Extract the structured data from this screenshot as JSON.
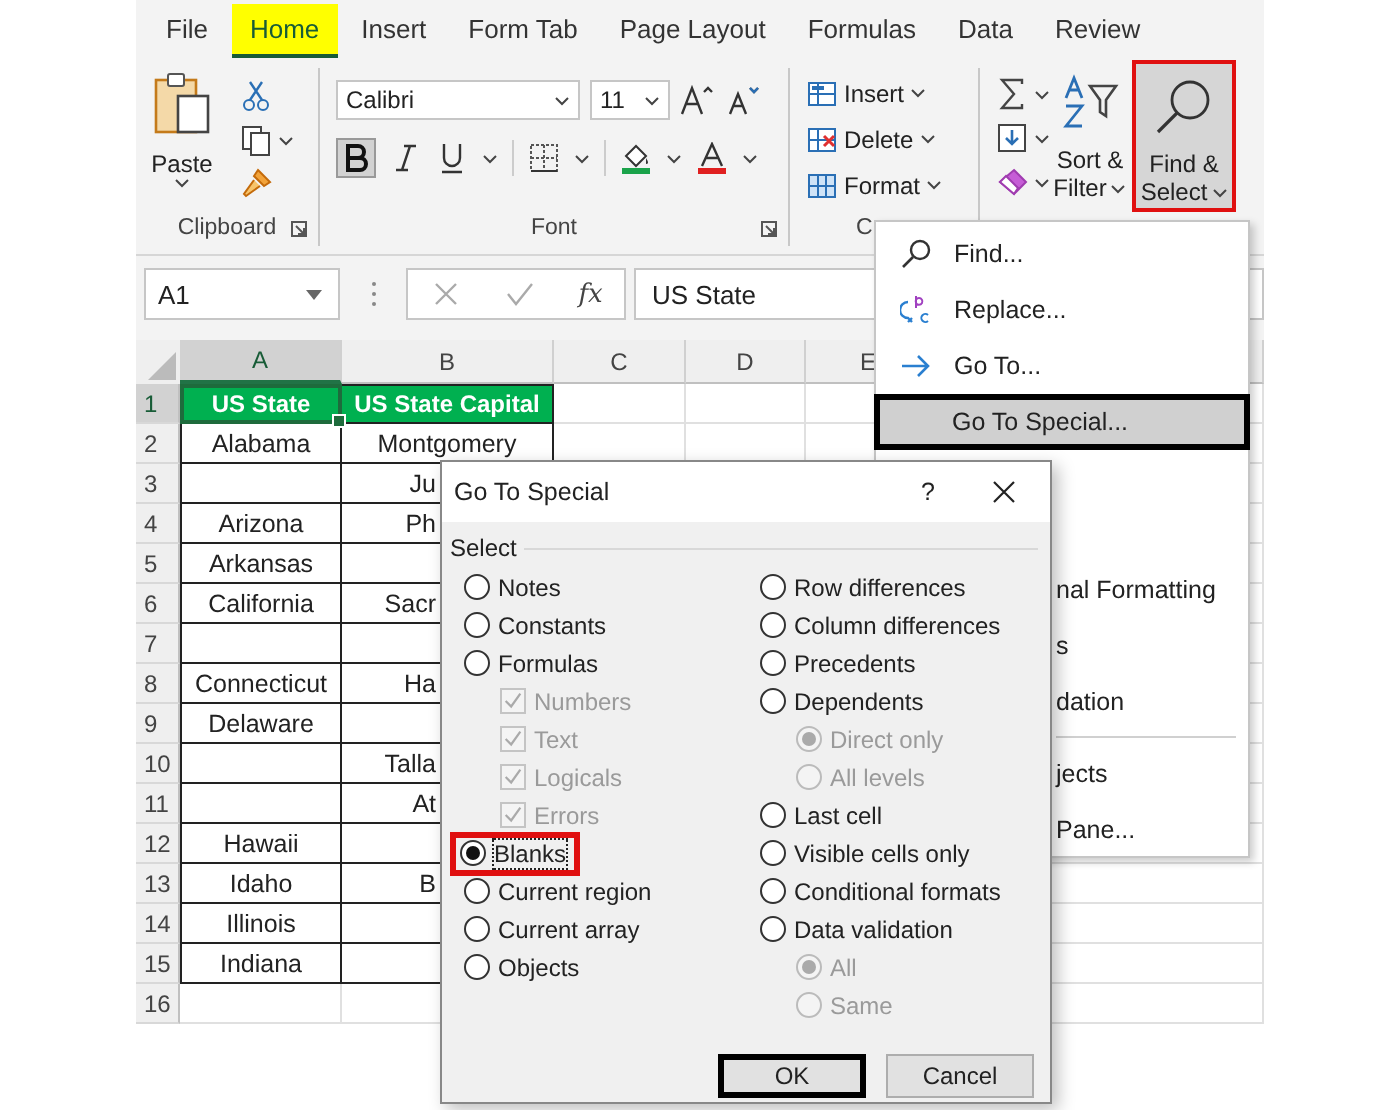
{
  "ribbon_tabs": [
    {
      "label": "File",
      "selected": false,
      "highlighted": false
    },
    {
      "label": "Home",
      "selected": true,
      "highlighted": true
    },
    {
      "label": "Insert",
      "selected": false,
      "highlighted": false
    },
    {
      "label": "Form Tab",
      "selected": false,
      "highlighted": false
    },
    {
      "label": "Page Layout",
      "selected": false,
      "highlighted": false
    },
    {
      "label": "Formulas",
      "selected": false,
      "highlighted": false
    },
    {
      "label": "Data",
      "selected": false,
      "highlighted": false
    },
    {
      "label": "Review",
      "selected": false,
      "highlighted": false
    }
  ],
  "ribbon": {
    "clipboard": {
      "paste_label": "Paste",
      "group_label": "Clipboard"
    },
    "font": {
      "font_name": "Calibri",
      "font_size": "11",
      "bold_on": true,
      "group_label": "Font"
    },
    "cells": {
      "buttons": [
        {
          "label": "Insert"
        },
        {
          "label": "Delete"
        },
        {
          "label": "Format"
        }
      ],
      "group_label": "C"
    },
    "editing": {
      "sort_label": "Sort &",
      "sort_label_2": "Filter",
      "find_label": "Find &",
      "find_label_2": "Select",
      "find_highlighted": true
    }
  },
  "formula_bar": {
    "name_box": "A1",
    "fx": "fx",
    "formula": "US State"
  },
  "sheet": {
    "columns": [
      {
        "label": "A",
        "selected": true
      },
      {
        "label": "B",
        "selected": false
      },
      {
        "label": "C",
        "selected": false
      },
      {
        "label": "D",
        "selected": false
      },
      {
        "label": "E",
        "selected": false
      }
    ],
    "rows": [
      {
        "number": "1",
        "selected": true,
        "kind": "header",
        "state": "US State",
        "capital": "US State Capital"
      },
      {
        "number": "2",
        "selected": false,
        "kind": "data",
        "state": "Alabama",
        "capital": "Montgomery"
      },
      {
        "number": "3",
        "selected": false,
        "kind": "data",
        "capital": "Ju"
      },
      {
        "number": "4",
        "selected": false,
        "kind": "data",
        "state": "Arizona",
        "capital": "Ph"
      },
      {
        "number": "5",
        "selected": false,
        "kind": "data",
        "state": "Arkansas"
      },
      {
        "number": "6",
        "selected": false,
        "kind": "data",
        "state": "California",
        "capital": "Sacr"
      },
      {
        "number": "7",
        "selected": false,
        "kind": "data"
      },
      {
        "number": "8",
        "selected": false,
        "kind": "data",
        "state": "Connecticut",
        "capital": "Ha"
      },
      {
        "number": "9",
        "selected": false,
        "kind": "data",
        "state": "Delaware"
      },
      {
        "number": "10",
        "selected": false,
        "kind": "data",
        "capital": "Talla"
      },
      {
        "number": "11",
        "selected": false,
        "kind": "data",
        "capital": "At"
      },
      {
        "number": "12",
        "selected": false,
        "kind": "data",
        "state": "Hawaii"
      },
      {
        "number": "13",
        "selected": false,
        "kind": "data",
        "state": "Idaho",
        "capital": "B"
      },
      {
        "number": "14",
        "selected": false,
        "kind": "data",
        "state": "Illinois"
      },
      {
        "number": "15",
        "selected": false,
        "kind": "data",
        "state": "Indiana"
      },
      {
        "number": "16",
        "selected": false,
        "kind": "blank"
      }
    ]
  },
  "menu": {
    "items": [
      {
        "label": "Find...",
        "selected": false
      },
      {
        "label": "Replace...",
        "selected": false
      },
      {
        "label": "Go To...",
        "selected": false
      },
      {
        "label": "Go To Special...",
        "selected": true
      }
    ],
    "lower_items": [
      {
        "kind": "item",
        "label": "nal Formatting"
      },
      {
        "kind": "item",
        "label": "s"
      },
      {
        "kind": "item",
        "label": "dation"
      },
      {
        "kind": "separator"
      },
      {
        "kind": "item",
        "label": "jects"
      },
      {
        "kind": "item",
        "label": "Pane..."
      }
    ]
  },
  "dialog": {
    "title": "Go To Special",
    "help": "?",
    "group_label": "Select",
    "left_options": [
      {
        "kind": "radio",
        "label": "Notes",
        "selected": false,
        "disabled": false,
        "highlighted": false
      },
      {
        "kind": "radio",
        "label": "Constants",
        "selected": false,
        "disabled": false,
        "highlighted": false
      },
      {
        "kind": "radio",
        "label": "Formulas",
        "selected": false,
        "disabled": false,
        "highlighted": false
      },
      {
        "kind": "checkbox",
        "label": "Numbers",
        "checked": true,
        "disabled": true
      },
      {
        "kind": "checkbox",
        "label": "Text",
        "checked": true,
        "disabled": true
      },
      {
        "kind": "checkbox",
        "label": "Logicals",
        "checked": true,
        "disabled": true
      },
      {
        "kind": "checkbox",
        "label": "Errors",
        "checked": true,
        "disabled": true
      },
      {
        "kind": "radio",
        "label": "Blanks",
        "selected": true,
        "disabled": false,
        "highlighted": true
      },
      {
        "kind": "radio",
        "label": "Current region",
        "selected": false,
        "disabled": false,
        "highlighted": false
      },
      {
        "kind": "radio",
        "label": "Current array",
        "selected": false,
        "disabled": false,
        "highlighted": false
      },
      {
        "kind": "radio",
        "label": "Objects",
        "selected": false,
        "disabled": false,
        "highlighted": false
      }
    ],
    "right_options": [
      {
        "kind": "radio",
        "label": "Row differences",
        "selected": false,
        "disabled": false,
        "highlighted": false
      },
      {
        "kind": "radio",
        "label": "Column differences",
        "selected": false,
        "disabled": false,
        "highlighted": false
      },
      {
        "kind": "radio",
        "label": "Precedents",
        "selected": false,
        "disabled": false,
        "highlighted": false
      },
      {
        "kind": "radio",
        "label": "Dependents",
        "selected": false,
        "disabled": false,
        "highlighted": false
      },
      {
        "kind": "subradio",
        "label": "Direct only",
        "selected": true,
        "disabled": true,
        "highlighted": false
      },
      {
        "kind": "subradio",
        "label": "All levels",
        "selected": false,
        "disabled": true,
        "highlighted": false
      },
      {
        "kind": "radio",
        "label": "Last cell",
        "selected": false,
        "disabled": false,
        "highlighted": false
      },
      {
        "kind": "radio",
        "label": "Visible cells only",
        "selected": false,
        "disabled": false,
        "highlighted": false
      },
      {
        "kind": "radio",
        "label": "Conditional formats",
        "selected": false,
        "disabled": false,
        "highlighted": false
      },
      {
        "kind": "radio",
        "label": "Data validation",
        "selected": false,
        "disabled": false,
        "highlighted": false
      },
      {
        "kind": "subradio",
        "label": "All",
        "selected": true,
        "disabled": true,
        "highlighted": false
      },
      {
        "kind": "subradio",
        "label": "Same",
        "selected": false,
        "disabled": true,
        "highlighted": false
      }
    ],
    "buttons": [
      {
        "label": "OK",
        "default": true
      },
      {
        "label": "Cancel",
        "default": false
      }
    ]
  }
}
